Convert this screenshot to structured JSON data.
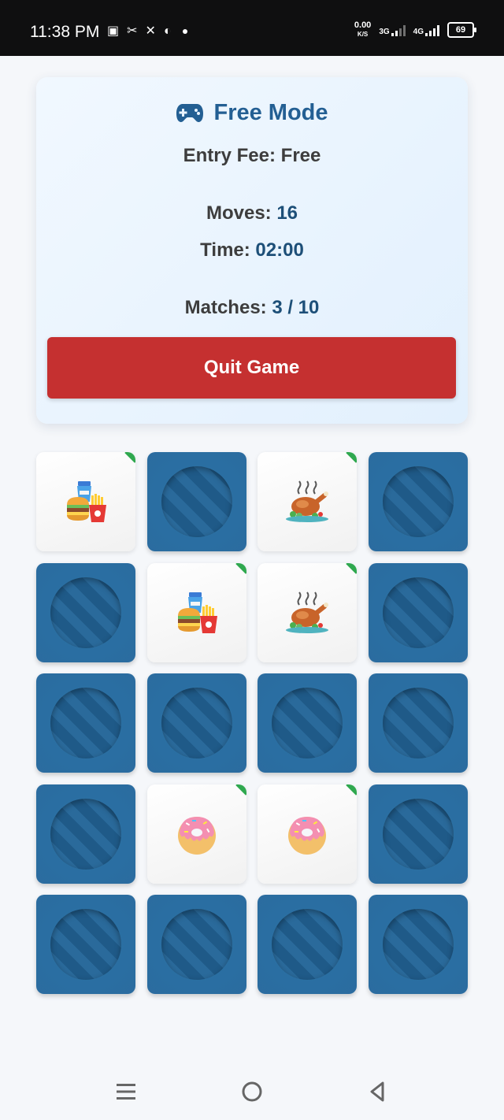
{
  "status_bar": {
    "time": "11:38 PM",
    "speed_value": "0.00",
    "speed_unit": "K/S",
    "net1": "3G",
    "net2": "4G",
    "battery": "69"
  },
  "game": {
    "mode_title": "Free Mode",
    "entry_label": "Entry Fee:",
    "entry_value": "Free",
    "moves_label": "Moves:",
    "moves_value": "16",
    "time_label": "Time:",
    "time_value": "02:00",
    "matches_label": "Matches:",
    "matches_value": "3 / 10",
    "quit_label": "Quit Game"
  },
  "board": {
    "tiles": [
      {
        "state": "matched",
        "icon": "fast-food"
      },
      {
        "state": "hidden"
      },
      {
        "state": "matched",
        "icon": "roast-chicken"
      },
      {
        "state": "hidden"
      },
      {
        "state": "hidden"
      },
      {
        "state": "matched",
        "icon": "fast-food"
      },
      {
        "state": "matched",
        "icon": "roast-chicken"
      },
      {
        "state": "hidden"
      },
      {
        "state": "hidden"
      },
      {
        "state": "hidden"
      },
      {
        "state": "hidden"
      },
      {
        "state": "hidden"
      },
      {
        "state": "hidden"
      },
      {
        "state": "matched",
        "icon": "donut"
      },
      {
        "state": "matched",
        "icon": "donut"
      },
      {
        "state": "hidden"
      },
      {
        "state": "hidden"
      },
      {
        "state": "hidden"
      },
      {
        "state": "hidden"
      },
      {
        "state": "hidden"
      }
    ]
  },
  "colors": {
    "accent": "#235f93",
    "tile_back": "#2b6c9f",
    "quit_button": "#c53030",
    "match_marker": "#2fa84f"
  }
}
